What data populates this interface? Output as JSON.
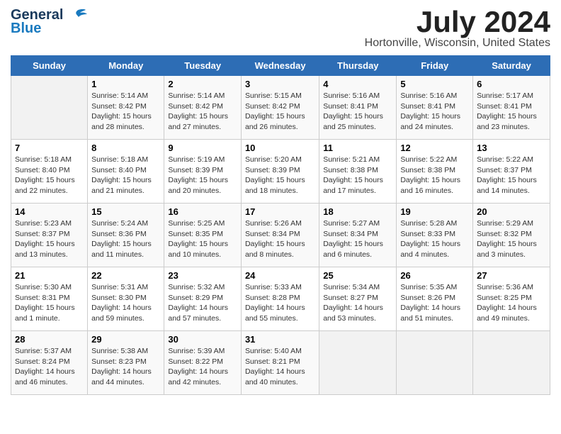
{
  "header": {
    "logo_line1": "General",
    "logo_line2": "Blue",
    "month_title": "July 2024",
    "location": "Hortonville, Wisconsin, United States"
  },
  "days_of_week": [
    "Sunday",
    "Monday",
    "Tuesday",
    "Wednesday",
    "Thursday",
    "Friday",
    "Saturday"
  ],
  "weeks": [
    [
      {
        "num": "",
        "info": ""
      },
      {
        "num": "1",
        "info": "Sunrise: 5:14 AM\nSunset: 8:42 PM\nDaylight: 15 hours\nand 28 minutes."
      },
      {
        "num": "2",
        "info": "Sunrise: 5:14 AM\nSunset: 8:42 PM\nDaylight: 15 hours\nand 27 minutes."
      },
      {
        "num": "3",
        "info": "Sunrise: 5:15 AM\nSunset: 8:42 PM\nDaylight: 15 hours\nand 26 minutes."
      },
      {
        "num": "4",
        "info": "Sunrise: 5:16 AM\nSunset: 8:41 PM\nDaylight: 15 hours\nand 25 minutes."
      },
      {
        "num": "5",
        "info": "Sunrise: 5:16 AM\nSunset: 8:41 PM\nDaylight: 15 hours\nand 24 minutes."
      },
      {
        "num": "6",
        "info": "Sunrise: 5:17 AM\nSunset: 8:41 PM\nDaylight: 15 hours\nand 23 minutes."
      }
    ],
    [
      {
        "num": "7",
        "info": "Sunrise: 5:18 AM\nSunset: 8:40 PM\nDaylight: 15 hours\nand 22 minutes."
      },
      {
        "num": "8",
        "info": "Sunrise: 5:18 AM\nSunset: 8:40 PM\nDaylight: 15 hours\nand 21 minutes."
      },
      {
        "num": "9",
        "info": "Sunrise: 5:19 AM\nSunset: 8:39 PM\nDaylight: 15 hours\nand 20 minutes."
      },
      {
        "num": "10",
        "info": "Sunrise: 5:20 AM\nSunset: 8:39 PM\nDaylight: 15 hours\nand 18 minutes."
      },
      {
        "num": "11",
        "info": "Sunrise: 5:21 AM\nSunset: 8:38 PM\nDaylight: 15 hours\nand 17 minutes."
      },
      {
        "num": "12",
        "info": "Sunrise: 5:22 AM\nSunset: 8:38 PM\nDaylight: 15 hours\nand 16 minutes."
      },
      {
        "num": "13",
        "info": "Sunrise: 5:22 AM\nSunset: 8:37 PM\nDaylight: 15 hours\nand 14 minutes."
      }
    ],
    [
      {
        "num": "14",
        "info": "Sunrise: 5:23 AM\nSunset: 8:37 PM\nDaylight: 15 hours\nand 13 minutes."
      },
      {
        "num": "15",
        "info": "Sunrise: 5:24 AM\nSunset: 8:36 PM\nDaylight: 15 hours\nand 11 minutes."
      },
      {
        "num": "16",
        "info": "Sunrise: 5:25 AM\nSunset: 8:35 PM\nDaylight: 15 hours\nand 10 minutes."
      },
      {
        "num": "17",
        "info": "Sunrise: 5:26 AM\nSunset: 8:34 PM\nDaylight: 15 hours\nand 8 minutes."
      },
      {
        "num": "18",
        "info": "Sunrise: 5:27 AM\nSunset: 8:34 PM\nDaylight: 15 hours\nand 6 minutes."
      },
      {
        "num": "19",
        "info": "Sunrise: 5:28 AM\nSunset: 8:33 PM\nDaylight: 15 hours\nand 4 minutes."
      },
      {
        "num": "20",
        "info": "Sunrise: 5:29 AM\nSunset: 8:32 PM\nDaylight: 15 hours\nand 3 minutes."
      }
    ],
    [
      {
        "num": "21",
        "info": "Sunrise: 5:30 AM\nSunset: 8:31 PM\nDaylight: 15 hours\nand 1 minute."
      },
      {
        "num": "22",
        "info": "Sunrise: 5:31 AM\nSunset: 8:30 PM\nDaylight: 14 hours\nand 59 minutes."
      },
      {
        "num": "23",
        "info": "Sunrise: 5:32 AM\nSunset: 8:29 PM\nDaylight: 14 hours\nand 57 minutes."
      },
      {
        "num": "24",
        "info": "Sunrise: 5:33 AM\nSunset: 8:28 PM\nDaylight: 14 hours\nand 55 minutes."
      },
      {
        "num": "25",
        "info": "Sunrise: 5:34 AM\nSunset: 8:27 PM\nDaylight: 14 hours\nand 53 minutes."
      },
      {
        "num": "26",
        "info": "Sunrise: 5:35 AM\nSunset: 8:26 PM\nDaylight: 14 hours\nand 51 minutes."
      },
      {
        "num": "27",
        "info": "Sunrise: 5:36 AM\nSunset: 8:25 PM\nDaylight: 14 hours\nand 49 minutes."
      }
    ],
    [
      {
        "num": "28",
        "info": "Sunrise: 5:37 AM\nSunset: 8:24 PM\nDaylight: 14 hours\nand 46 minutes."
      },
      {
        "num": "29",
        "info": "Sunrise: 5:38 AM\nSunset: 8:23 PM\nDaylight: 14 hours\nand 44 minutes."
      },
      {
        "num": "30",
        "info": "Sunrise: 5:39 AM\nSunset: 8:22 PM\nDaylight: 14 hours\nand 42 minutes."
      },
      {
        "num": "31",
        "info": "Sunrise: 5:40 AM\nSunset: 8:21 PM\nDaylight: 14 hours\nand 40 minutes."
      },
      {
        "num": "",
        "info": ""
      },
      {
        "num": "",
        "info": ""
      },
      {
        "num": "",
        "info": ""
      }
    ]
  ]
}
